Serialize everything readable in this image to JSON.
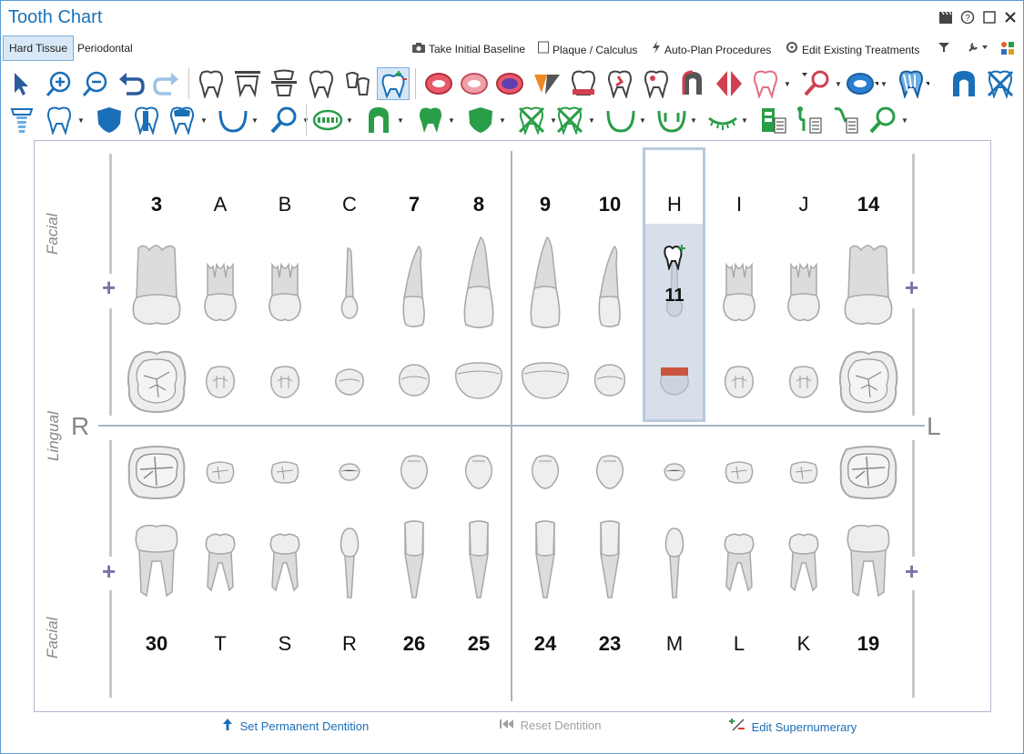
{
  "window": {
    "title": "Tooth Chart"
  },
  "tabs": [
    {
      "label": "Hard Tissue",
      "active": true
    },
    {
      "label": "Periodontal",
      "active": false
    }
  ],
  "options": {
    "baseline": "Take Initial Baseline",
    "plaque": "Plaque / Calculus",
    "autoplan": "Auto-Plan Procedures",
    "edit_existing": "Edit Existing Treatments"
  },
  "chart": {
    "side_top": "Facial",
    "side_middle": "Lingual",
    "side_bottom": "Facial",
    "right_label": "R",
    "left_label": "L",
    "upper": [
      {
        "label": "3",
        "bold": true
      },
      {
        "label": "A",
        "bold": false
      },
      {
        "label": "B",
        "bold": false
      },
      {
        "label": "C",
        "bold": false
      },
      {
        "label": "7",
        "bold": true
      },
      {
        "label": "8",
        "bold": true
      },
      {
        "label": "9",
        "bold": true
      },
      {
        "label": "10",
        "bold": true
      },
      {
        "label": "H",
        "bold": false,
        "selected": true,
        "overlay": "11"
      },
      {
        "label": "I",
        "bold": false
      },
      {
        "label": "J",
        "bold": false
      },
      {
        "label": "14",
        "bold": true
      }
    ],
    "lower": [
      {
        "label": "30",
        "bold": true
      },
      {
        "label": "T",
        "bold": false
      },
      {
        "label": "S",
        "bold": false
      },
      {
        "label": "R",
        "bold": false
      },
      {
        "label": "26",
        "bold": true
      },
      {
        "label": "25",
        "bold": true
      },
      {
        "label": "24",
        "bold": true
      },
      {
        "label": "23",
        "bold": true
      },
      {
        "label": "M",
        "bold": false
      },
      {
        "label": "L",
        "bold": false
      },
      {
        "label": "K",
        "bold": false
      },
      {
        "label": "19",
        "bold": true
      }
    ]
  },
  "footer": {
    "set_permanent": "Set Permanent Dentition",
    "reset": "Reset Dentition",
    "edit_super": "Edit Supernumerary"
  },
  "colors": {
    "accent": "#1a73b8",
    "selection": "#d7e0ea",
    "tooth": "#dcdcdc",
    "tooth_outline": "#a8a8a8",
    "restoration": "#c8553d"
  }
}
